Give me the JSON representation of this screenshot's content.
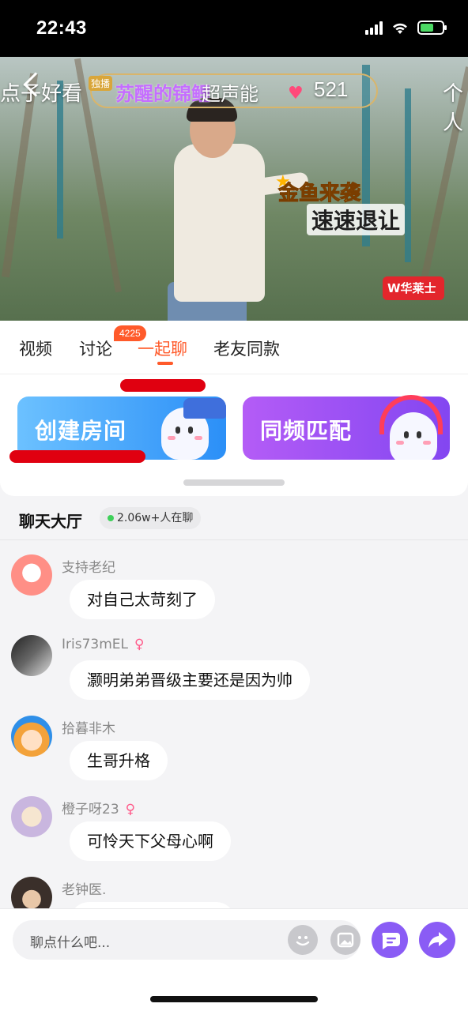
{
  "status_bar": {
    "time": "22:43"
  },
  "video": {
    "left_text": "点子好看",
    "exclusive_badge": "独播",
    "title_purple": "苏醒的锦鲤",
    "title_white": "超声能",
    "likes": "521",
    "right_text": "个人",
    "caption_line1": "金鱼来袭",
    "caption_line2": "速速退让",
    "brand": "W华莱士"
  },
  "tabs": [
    {
      "label": "视频"
    },
    {
      "label": "讨论",
      "badge": "4225"
    },
    {
      "label": "一起聊"
    },
    {
      "label": "老友同款"
    }
  ],
  "cards": {
    "create_room": "创建房间",
    "match": "同频匹配"
  },
  "lobby": {
    "title": "聊天大厅",
    "online": "2.06w+人在聊"
  },
  "messages": [
    {
      "user": "支持老纪",
      "text": "对自己太苛刻了",
      "female": false
    },
    {
      "user": "Iris73mEL",
      "text": "灏明弟弟晋级主要还是因为帅",
      "female": true
    },
    {
      "user": "拾暮非木",
      "text": "生哥升格",
      "female": false
    },
    {
      "user": "橙子呀23",
      "text": "可怜天下父母心啊",
      "female": true
    },
    {
      "user": "老钟医.",
      "text": "",
      "female": false
    }
  ],
  "gender_symbol": "♀",
  "composer": {
    "placeholder": "聊点什么吧..."
  },
  "colors": {
    "accent": "#ff5a2a",
    "action_purple": "#8a5cf5"
  }
}
